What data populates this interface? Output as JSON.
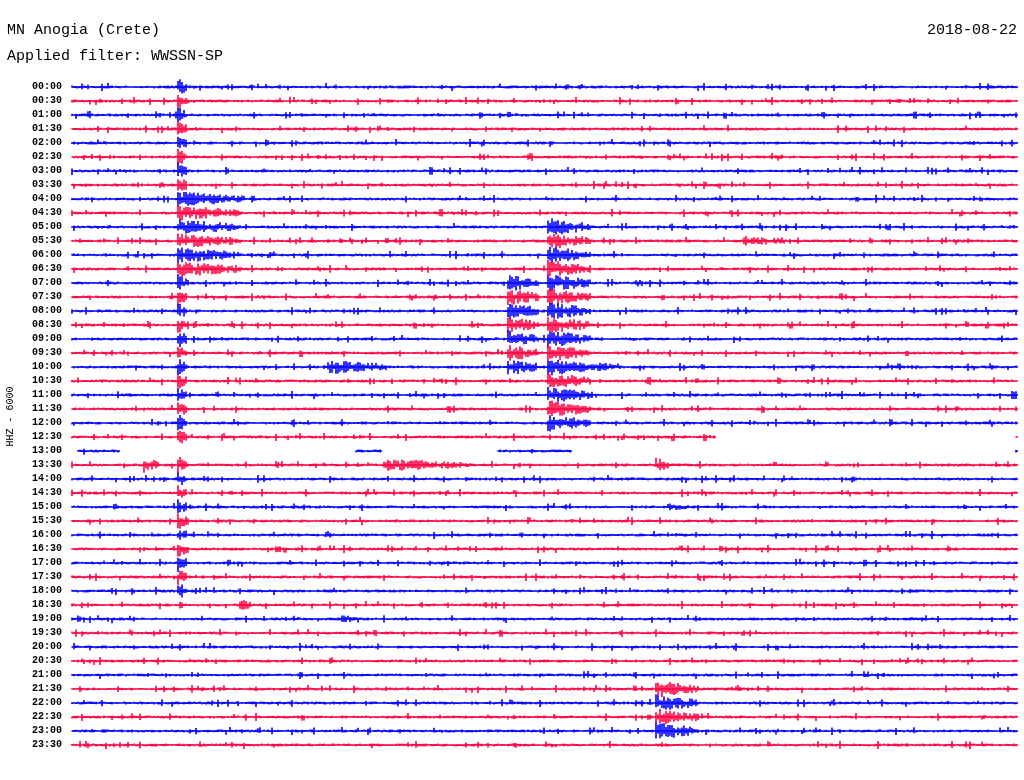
{
  "title": "MN Anogia (Crete)",
  "date": "2018-08-22",
  "filter": "Applied filter: WWSSN-SP",
  "channel": "HHZ - 6000",
  "rows": [
    {
      "time": "00:00",
      "color": "#0000ff"
    },
    {
      "time": "00:30",
      "color": "#ff0040"
    },
    {
      "time": "01:00",
      "color": "#0000ff"
    },
    {
      "time": "01:30",
      "color": "#ff0040"
    },
    {
      "time": "02:00",
      "color": "#0000ff"
    },
    {
      "time": "02:30",
      "color": "#ff0040"
    },
    {
      "time": "03:00",
      "color": "#0000ff"
    },
    {
      "time": "03:30",
      "color": "#ff0040"
    },
    {
      "time": "04:00",
      "color": "#0000ff"
    },
    {
      "time": "04:30",
      "color": "#ff0040"
    },
    {
      "time": "05:00",
      "color": "#0000ff"
    },
    {
      "time": "05:30",
      "color": "#ff0040"
    },
    {
      "time": "06:00",
      "color": "#0000ff"
    },
    {
      "time": "06:30",
      "color": "#ff0040"
    },
    {
      "time": "07:00",
      "color": "#0000ff"
    },
    {
      "time": "07:30",
      "color": "#ff0040"
    },
    {
      "time": "08:00",
      "color": "#0000ff"
    },
    {
      "time": "08:30",
      "color": "#ff0040"
    },
    {
      "time": "09:00",
      "color": "#0000ff"
    },
    {
      "time": "09:30",
      "color": "#ff0040"
    },
    {
      "time": "10:00",
      "color": "#0000ff"
    },
    {
      "time": "10:30",
      "color": "#ff0040"
    },
    {
      "time": "11:00",
      "color": "#0000ff"
    },
    {
      "time": "11:30",
      "color": "#ff0040"
    },
    {
      "time": "12:00",
      "color": "#0000ff"
    },
    {
      "time": "12:30",
      "color": "#ff0040"
    },
    {
      "time": "13:00",
      "color": "#0000ff"
    },
    {
      "time": "13:30",
      "color": "#ff0040"
    },
    {
      "time": "14:00",
      "color": "#0000ff"
    },
    {
      "time": "14:30",
      "color": "#ff0040"
    },
    {
      "time": "15:00",
      "color": "#0000ff"
    },
    {
      "time": "15:30",
      "color": "#ff0040"
    },
    {
      "time": "16:00",
      "color": "#0000ff"
    },
    {
      "time": "16:30",
      "color": "#ff0040"
    },
    {
      "time": "17:00",
      "color": "#0000ff"
    },
    {
      "time": "17:30",
      "color": "#ff0040"
    },
    {
      "time": "18:00",
      "color": "#0000ff"
    },
    {
      "time": "18:30",
      "color": "#ff0040"
    },
    {
      "time": "19:00",
      "color": "#0000ff"
    },
    {
      "time": "19:30",
      "color": "#ff0040"
    },
    {
      "time": "20:00",
      "color": "#0000ff"
    },
    {
      "time": "20:30",
      "color": "#ff0040"
    },
    {
      "time": "21:00",
      "color": "#0000ff"
    },
    {
      "time": "21:30",
      "color": "#ff0040"
    },
    {
      "time": "22:00",
      "color": "#0000ff"
    },
    {
      "time": "22:30",
      "color": "#ff0040"
    },
    {
      "time": "23:00",
      "color": "#0000ff"
    },
    {
      "time": "23:30",
      "color": "#ff0040"
    }
  ]
}
